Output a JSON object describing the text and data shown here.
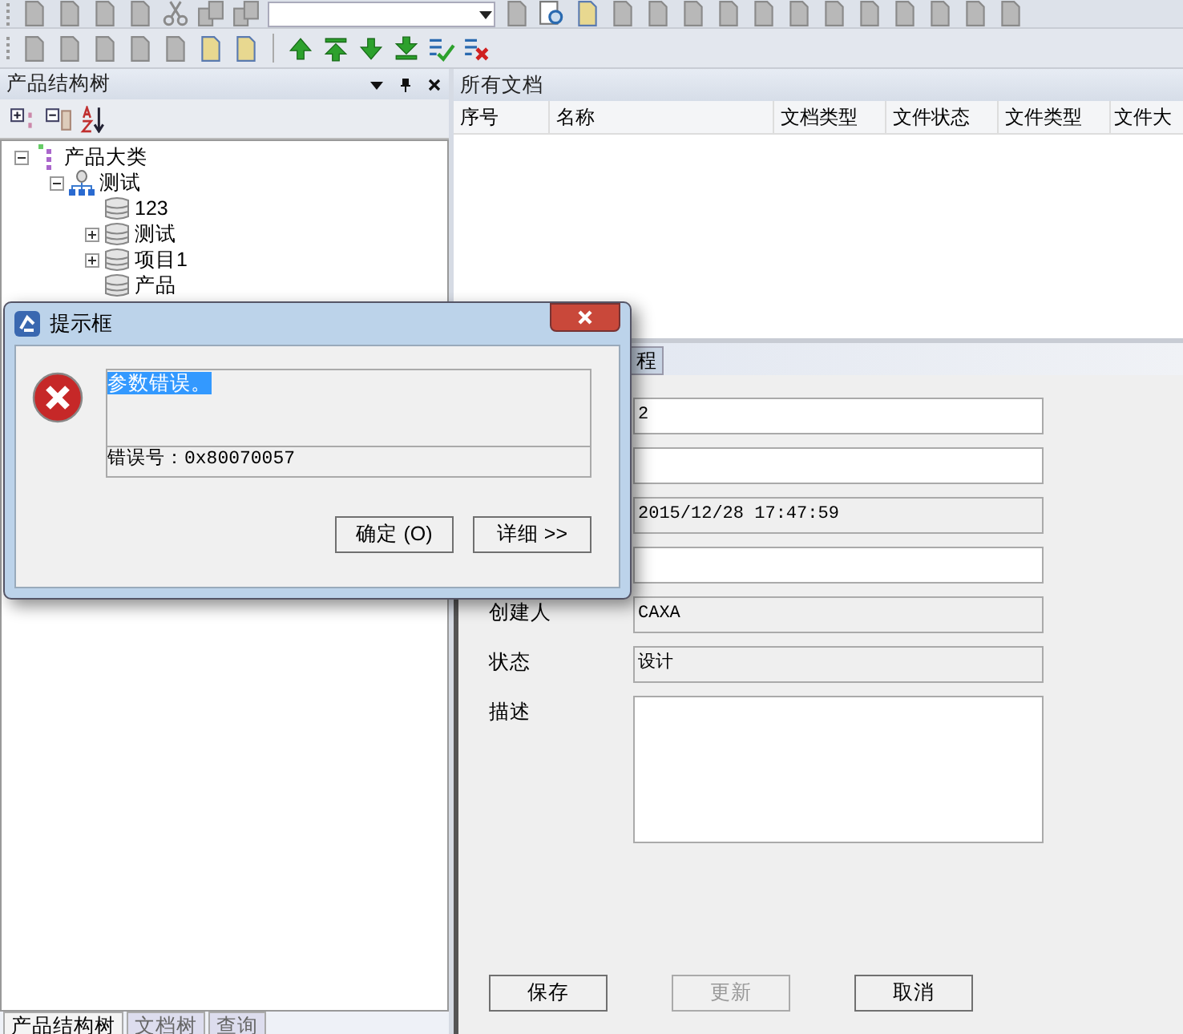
{
  "toolbar_top": [
    {
      "kind": "doc",
      "disabled": true
    },
    {
      "kind": "doc",
      "disabled": true
    },
    {
      "kind": "doc",
      "disabled": true
    },
    {
      "kind": "doc",
      "disabled": true
    },
    {
      "kind": "cut",
      "disabled": true
    },
    {
      "kind": "copy",
      "disabled": true
    },
    {
      "kind": "copy",
      "disabled": true
    },
    {
      "kind": "combo",
      "disabled": false
    },
    {
      "kind": "doc",
      "disabled": true
    },
    {
      "kind": "search",
      "disabled": false
    },
    {
      "kind": "doc",
      "disabled": false
    },
    {
      "kind": "doc",
      "disabled": true
    },
    {
      "kind": "doc",
      "disabled": true
    },
    {
      "kind": "doc",
      "disabled": true
    },
    {
      "kind": "doc",
      "disabled": true
    },
    {
      "kind": "doc",
      "disabled": true
    },
    {
      "kind": "doc",
      "disabled": true
    },
    {
      "kind": "doc",
      "disabled": true
    },
    {
      "kind": "doc",
      "disabled": true
    },
    {
      "kind": "doc",
      "disabled": true
    },
    {
      "kind": "doc",
      "disabled": true
    },
    {
      "kind": "doc",
      "disabled": true
    },
    {
      "kind": "doc",
      "disabled": true
    }
  ],
  "toolbar_second": [
    {
      "kind": "doc",
      "disabled": true
    },
    {
      "kind": "doc",
      "disabled": true
    },
    {
      "kind": "doc",
      "disabled": true
    },
    {
      "kind": "doc",
      "disabled": true
    },
    {
      "kind": "doc",
      "disabled": true
    },
    {
      "kind": "doc",
      "disabled": false
    },
    {
      "kind": "doc",
      "disabled": false
    },
    {
      "kind": "up",
      "disabled": false
    },
    {
      "kind": "top",
      "disabled": false
    },
    {
      "kind": "down",
      "disabled": false
    },
    {
      "kind": "bottom",
      "disabled": false
    },
    {
      "kind": "check",
      "disabled": false
    },
    {
      "kind": "delete",
      "disabled": false
    }
  ],
  "left_panel": {
    "title": "产品结构树",
    "tree": [
      {
        "label": "产品大类",
        "kind": "category",
        "expanded": true,
        "children": [
          {
            "label": "测试",
            "kind": "assembly",
            "expanded": true,
            "children": [
              {
                "label": "123",
                "kind": "part"
              },
              {
                "label": "测试",
                "kind": "part",
                "expanded": false
              },
              {
                "label": "项目1",
                "kind": "part",
                "expanded": false
              },
              {
                "label": "产品",
                "kind": "part"
              }
            ]
          }
        ]
      }
    ],
    "tabs": [
      {
        "label": "产品结构树",
        "selected": true
      },
      {
        "label": "文档树",
        "selected": false
      },
      {
        "label": "查询",
        "selected": false
      }
    ]
  },
  "documents": {
    "title": "所有文档",
    "columns": [
      "序号",
      "名称",
      "文档类型",
      "文件状态",
      "文件类型",
      "文件大"
    ]
  },
  "properties": {
    "tab": "程",
    "fields": [
      {
        "value": "2",
        "readonly": false
      },
      {
        "readonly": false
      },
      {
        "value": "2015/12/28 17:47:59",
        "readonly": true
      },
      {
        "readonly": false
      },
      {
        "label": "创建人",
        "value": "CAXA",
        "readonly": true
      },
      {
        "label": "状态",
        "value": "设计",
        "readonly": true
      }
    ],
    "description_label": "描述",
    "buttons": [
      {
        "label": "保存",
        "disabled": false
      },
      {
        "label": "更新",
        "disabled": true
      },
      {
        "label": "取消",
        "disabled": false
      }
    ]
  },
  "dialog": {
    "title": "提示框",
    "message": "参数错误。",
    "message_selected": true,
    "error_code": "错误号：0x80070057",
    "buttons": [
      "确定 (O)",
      "详细 >>"
    ]
  }
}
